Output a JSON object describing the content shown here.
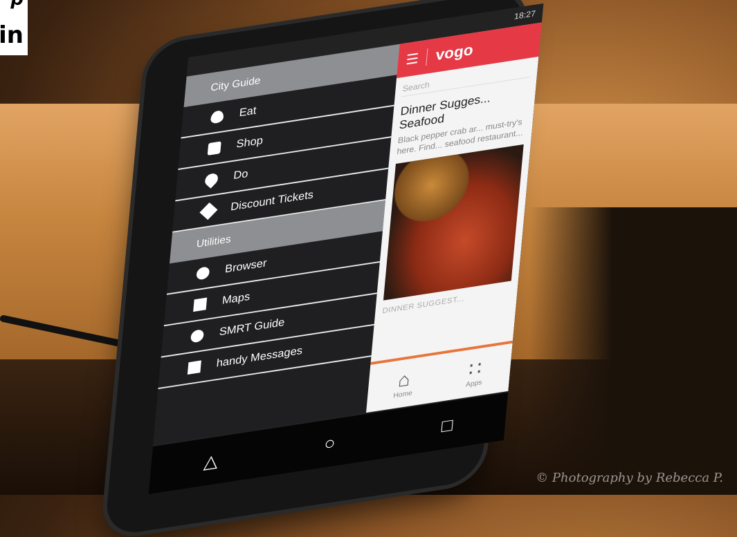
{
  "overlay": {
    "line1": "p",
    "line2": "in"
  },
  "status_bar": {
    "time": "18:27"
  },
  "drawer": {
    "sections": [
      {
        "title": "City Guide",
        "items": [
          {
            "label": "Eat",
            "icon": "utensil-icon"
          },
          {
            "label": "Shop",
            "icon": "shopping-bag-icon"
          },
          {
            "label": "Do",
            "icon": "location-pin-icon"
          },
          {
            "label": "Discount Tickets",
            "icon": "ticket-icon"
          }
        ]
      },
      {
        "title": "Utilities",
        "items": [
          {
            "label": "Browser",
            "icon": "globe-icon"
          },
          {
            "label": "Maps",
            "icon": "map-icon"
          },
          {
            "label": "SMRT Guide",
            "icon": "bus-icon"
          },
          {
            "label": "handy Messages",
            "icon": "envelope-icon"
          }
        ]
      }
    ]
  },
  "app": {
    "brand": "vogo",
    "search_placeholder": "Search",
    "card": {
      "title": "Dinner Sugges... Seafood",
      "description": "Black pepper crab ar... must-try's here. Find... seafood restaurant...",
      "footer_label": "DINNER SUGGEST..."
    },
    "tabs": [
      {
        "label": "Home",
        "icon": "home-icon"
      },
      {
        "label": "Apps",
        "icon": "grid-icon"
      }
    ]
  },
  "navbar": {
    "icons": [
      "back-icon",
      "home-circle-icon",
      "recents-icon"
    ]
  },
  "watermark": "© Photography by Rebecca P."
}
